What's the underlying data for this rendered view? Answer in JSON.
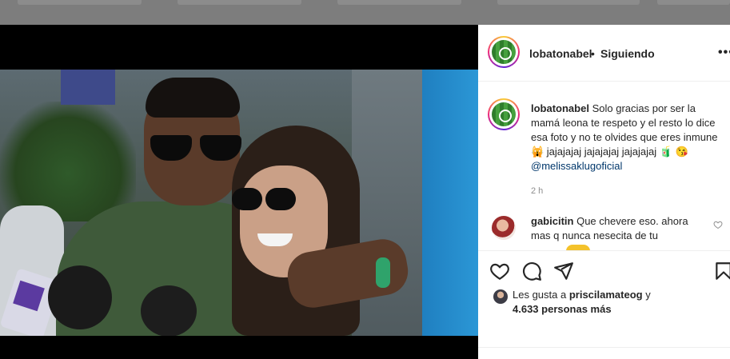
{
  "post": {
    "author": "lobatonabel",
    "separator": "•",
    "follow_status": "Siguiendo",
    "more_label": "•••"
  },
  "caption": {
    "user": "lobatonabel",
    "text": "Solo gracias por ser la mamá leona te respeto y el resto lo dice esa foto y no te olvides que eres inmune 🙀 jajajajaj jajajajaj jajajajaj 🧃 😘",
    "mention": "@melissaklugoficial",
    "time": "2 h"
  },
  "comments": [
    {
      "user": "gabicitin",
      "text": "Que chevere eso. ahora mas q nunca nesecita de tu"
    }
  ],
  "likes": {
    "prefix": "Les gusta a",
    "user": "priscilamateog",
    "conjunction": "y",
    "count_text": "4.633 personas más"
  },
  "icons": {
    "like": "heart-icon",
    "comment": "comment-icon",
    "share": "share-icon",
    "save": "bookmark-icon",
    "comment_like": "heart-icon",
    "more": "more-icon"
  },
  "colors": {
    "text": "#262626",
    "secondary": "#8e8e8e",
    "mention": "#00376b",
    "divider": "#efefef",
    "media_bg": "#000000"
  }
}
